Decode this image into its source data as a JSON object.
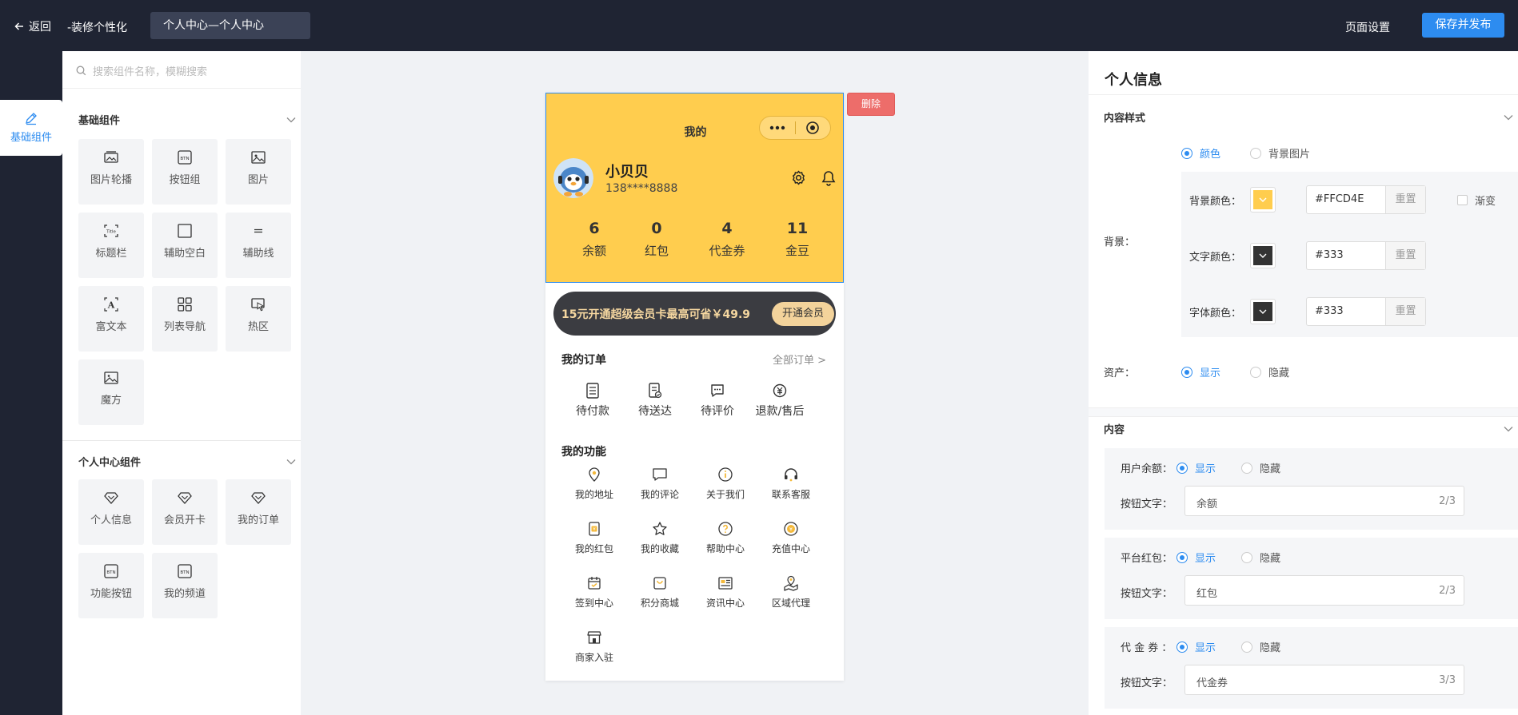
{
  "topbar": {
    "back_label": "返回",
    "title": "-装修个性化",
    "page_name": "个人中心—个人中心",
    "page_settings": "页面设置",
    "save_publish": "保存并发布"
  },
  "leftnav": {
    "active_item": "基础组件"
  },
  "component_panel": {
    "search_placeholder": "搜索组件名称，模糊搜索",
    "basic_section": {
      "title": "基础组件",
      "items": [
        {
          "label": "图片轮播",
          "icon": "image-carousel-icon"
        },
        {
          "label": "按钮组",
          "icon": "button-group-icon"
        },
        {
          "label": "图片",
          "icon": "image-icon"
        },
        {
          "label": "标题栏",
          "icon": "title-bar-icon"
        },
        {
          "label": "辅助空白",
          "icon": "blank-space-icon"
        },
        {
          "label": "辅助线",
          "icon": "divider-line-icon"
        },
        {
          "label": "富文本",
          "icon": "rich-text-icon"
        },
        {
          "label": "列表导航",
          "icon": "list-nav-icon"
        },
        {
          "label": "热区",
          "icon": "hot-zone-icon"
        },
        {
          "label": "魔方",
          "icon": "magic-cube-icon"
        }
      ]
    },
    "personal_section": {
      "title": "个人中心组件",
      "items": [
        {
          "label": "个人信息",
          "icon": "diamond-icon"
        },
        {
          "label": "会员开卡",
          "icon": "diamond-icon"
        },
        {
          "label": "我的订单",
          "icon": "diamond-icon"
        },
        {
          "label": "功能按钮",
          "icon": "button-icon"
        },
        {
          "label": "我的频道",
          "icon": "button-icon"
        }
      ]
    }
  },
  "phone": {
    "page_title": "我的",
    "user": {
      "name": "小贝贝",
      "phone": "138****8888"
    },
    "assets": [
      {
        "value": "6",
        "label": "余额"
      },
      {
        "value": "0",
        "label": "红包"
      },
      {
        "value": "4",
        "label": "代金券"
      },
      {
        "value": "11",
        "label": "金豆"
      }
    ],
    "vip": {
      "text": "15元开通超级会员卡最高可省￥49.9",
      "button": "开通会员"
    },
    "orders": {
      "title": "我的订单",
      "more": "全部订单 >",
      "items": [
        {
          "label": "待付款",
          "icon": "pending-payment-icon"
        },
        {
          "label": "待送达",
          "icon": "pending-delivery-icon"
        },
        {
          "label": "待评价",
          "icon": "pending-review-icon"
        },
        {
          "label": "退款/售后",
          "icon": "refund-icon"
        }
      ]
    },
    "functions": {
      "title": "我的功能",
      "items": [
        {
          "label": "我的地址",
          "icon": "location-pin-icon"
        },
        {
          "label": "我的评论",
          "icon": "comment-icon"
        },
        {
          "label": "关于我们",
          "icon": "info-icon"
        },
        {
          "label": "联系客服",
          "icon": "headset-icon"
        },
        {
          "label": "我的红包",
          "icon": "red-packet-icon"
        },
        {
          "label": "我的收藏",
          "icon": "star-icon"
        },
        {
          "label": "帮助中心",
          "icon": "help-icon"
        },
        {
          "label": "充值中心",
          "icon": "recharge-icon"
        },
        {
          "label": "签到中心",
          "icon": "calendar-icon"
        },
        {
          "label": "积分商城",
          "icon": "shopping-bag-icon"
        },
        {
          "label": "资讯中心",
          "icon": "news-icon"
        },
        {
          "label": "区域代理",
          "icon": "region-map-icon"
        },
        {
          "label": "商家入驻",
          "icon": "store-icon"
        }
      ]
    },
    "delete_button": "删除"
  },
  "settings": {
    "title": "个人信息",
    "content_style": {
      "title": "内容样式",
      "background_label": "背景：",
      "bg_type": {
        "options": [
          "颜色",
          "背景图片"
        ],
        "selected": "颜色"
      },
      "colors": [
        {
          "label": "背景颜色：",
          "value": "#FFCD4E",
          "reset": "重置",
          "swatch": "#FFCD4E"
        },
        {
          "label": "文字颜色：",
          "value": "#333",
          "reset": "重置",
          "swatch": "#333333"
        },
        {
          "label": "字体颜色：",
          "value": "#333",
          "reset": "重置",
          "swatch": "#333333"
        }
      ],
      "gradient_label": "渐变",
      "asset_label": "资产：",
      "asset_visibility": {
        "options": [
          "显示",
          "隐藏"
        ],
        "selected": "显示"
      }
    },
    "content": {
      "title": "内容",
      "button_text_label": "按钮文字：",
      "cards": [
        {
          "label": "用户余额：",
          "options": [
            "显示",
            "隐藏"
          ],
          "selected": "显示",
          "text": "余额",
          "count": "2/3"
        },
        {
          "label": "平台红包：",
          "options": [
            "显示",
            "隐藏"
          ],
          "selected": "显示",
          "text": "红包",
          "count": "2/3"
        },
        {
          "label": "代 金 券 ：",
          "options": [
            "显示",
            "隐藏"
          ],
          "selected": "显示",
          "text": "代金券",
          "count": "3/3"
        }
      ]
    }
  },
  "colors": {
    "accent": "#2d8cf0",
    "header_bg": "#FFCD4E",
    "topbar_bg": "#1f2433",
    "danger": "#ed6d6a"
  }
}
